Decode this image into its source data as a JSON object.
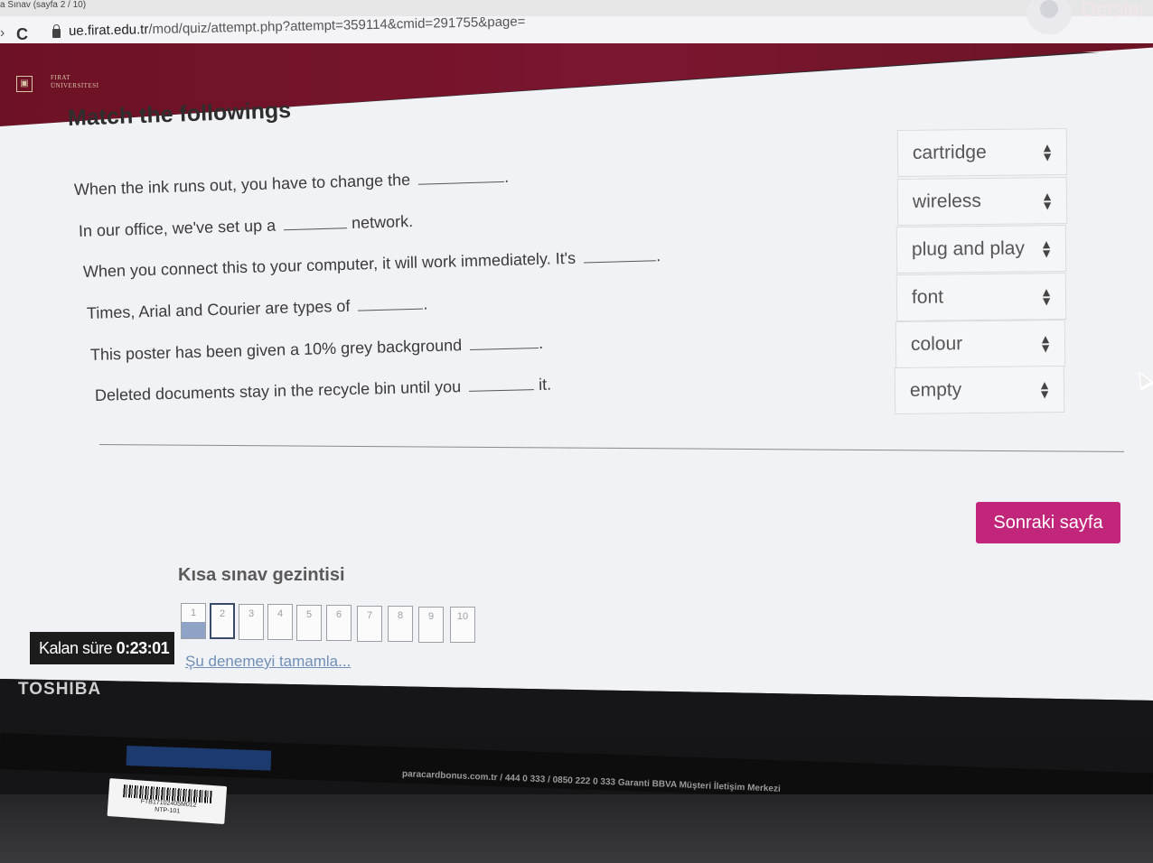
{
  "browser": {
    "tab_title": "a Sınav (sayfa 2 / 10)",
    "url_host": "ue.firat.edu.tr",
    "url_path": "/mod/quiz/attempt.php?attempt=359114&cmid=291755&page="
  },
  "header": {
    "logo_text_line1": "FIRAT",
    "logo_text_line2": "ÜNİVERSİTESİ",
    "nav_link": "Dersler"
  },
  "question": {
    "title": "Match the followings",
    "rows": [
      {
        "before": "When the ink runs out, you have to change the",
        "after": ".",
        "answer": "cartridge"
      },
      {
        "before": "In our office, we've set up a",
        "after": "network.",
        "answer": "wireless"
      },
      {
        "before": "When you connect this to your computer, it will work immediately. It's",
        "after": ".",
        "answer": "plug and play"
      },
      {
        "before": "Times, Arial and Courier are types of",
        "after": ".",
        "answer": "font"
      },
      {
        "before": "This poster has been given a 10% grey background",
        "after": ".",
        "answer": "colour"
      },
      {
        "before": "Deleted documents stay in the recycle bin until you",
        "after": "it.",
        "answer": "empty"
      }
    ]
  },
  "actions": {
    "next_page": "Sonraki sayfa"
  },
  "quiz_nav": {
    "title": "Kısa sınav gezintisi",
    "pages": [
      "1",
      "2",
      "3",
      "4",
      "5",
      "6",
      "7",
      "8",
      "9",
      "10"
    ],
    "answered_page": "1",
    "current_page": "2",
    "finish_link": "Şu denemeyi tamamla..."
  },
  "timer": {
    "label": "Kalan süre",
    "value": "0:23:01"
  },
  "device": {
    "brand": "TOSHIBA",
    "sticker_text": "paracardbonus.com.tr / 444 0 333 / 0850 222 0 333 Garanti BBVA Müşteri İletişim Merkezi",
    "barcode_code": "FTB17102405M012",
    "barcode_model": "NTP-101"
  },
  "colors": {
    "header_maroon": "#7b1630",
    "next_button": "#c2267a",
    "page_background": "#f1f2f5",
    "answered_fill": "#8fa3c7"
  }
}
